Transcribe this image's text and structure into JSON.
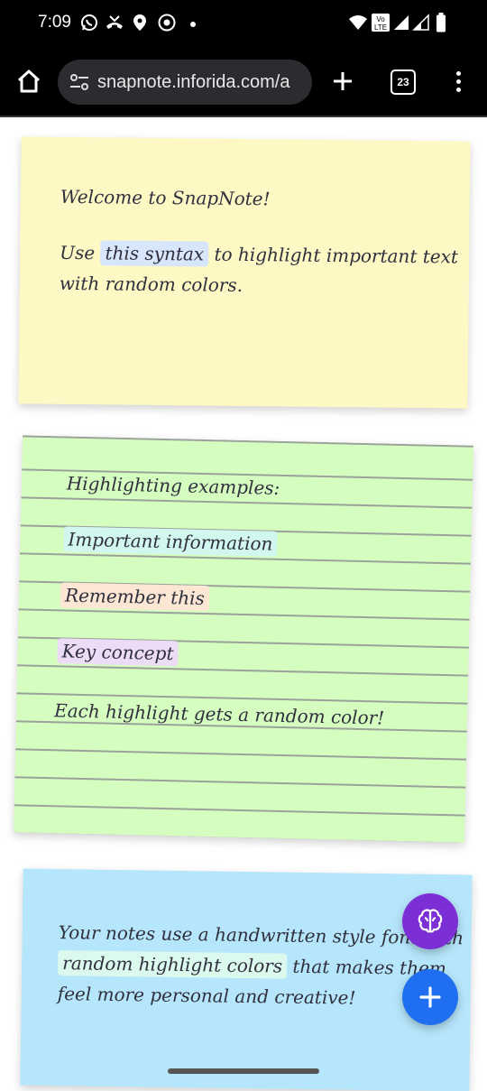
{
  "status_bar": {
    "time": "7:09",
    "icons": [
      "whatsapp-icon",
      "missed-call-icon",
      "location-pin-icon",
      "chrome-icon",
      "dot-icon",
      "wifi-icon",
      "volte-icon",
      "signal-icon",
      "signal-icon",
      "battery-icon"
    ],
    "volte_label": "Vo LTE"
  },
  "browser": {
    "url": "snapnote.inforida.com/a",
    "tab_count": "23"
  },
  "notes": [
    {
      "color": "#fdf8c4",
      "line1": "Welcome to SnapNote!",
      "line2_before": "Use",
      "line2_highlight": "this syntax",
      "line2_after": "to highlight important text",
      "line3": "with random colors."
    },
    {
      "color": "#d6fdc0",
      "title": "Highlighting examples:",
      "highlight1": "Important information",
      "highlight2": "Remember this",
      "highlight3": "Key concept",
      "footer": "Each highlight gets a random color!"
    },
    {
      "color": "#b6e6fb",
      "line1": "Your notes use a handwritten style font with",
      "line2_highlight": "random highlight colors",
      "line2_after": "that makes them",
      "line3": "feel more personal and creative!"
    }
  ],
  "fabs": {
    "brain_color": "#7c2fd4",
    "add_color": "#1f6ff0"
  }
}
